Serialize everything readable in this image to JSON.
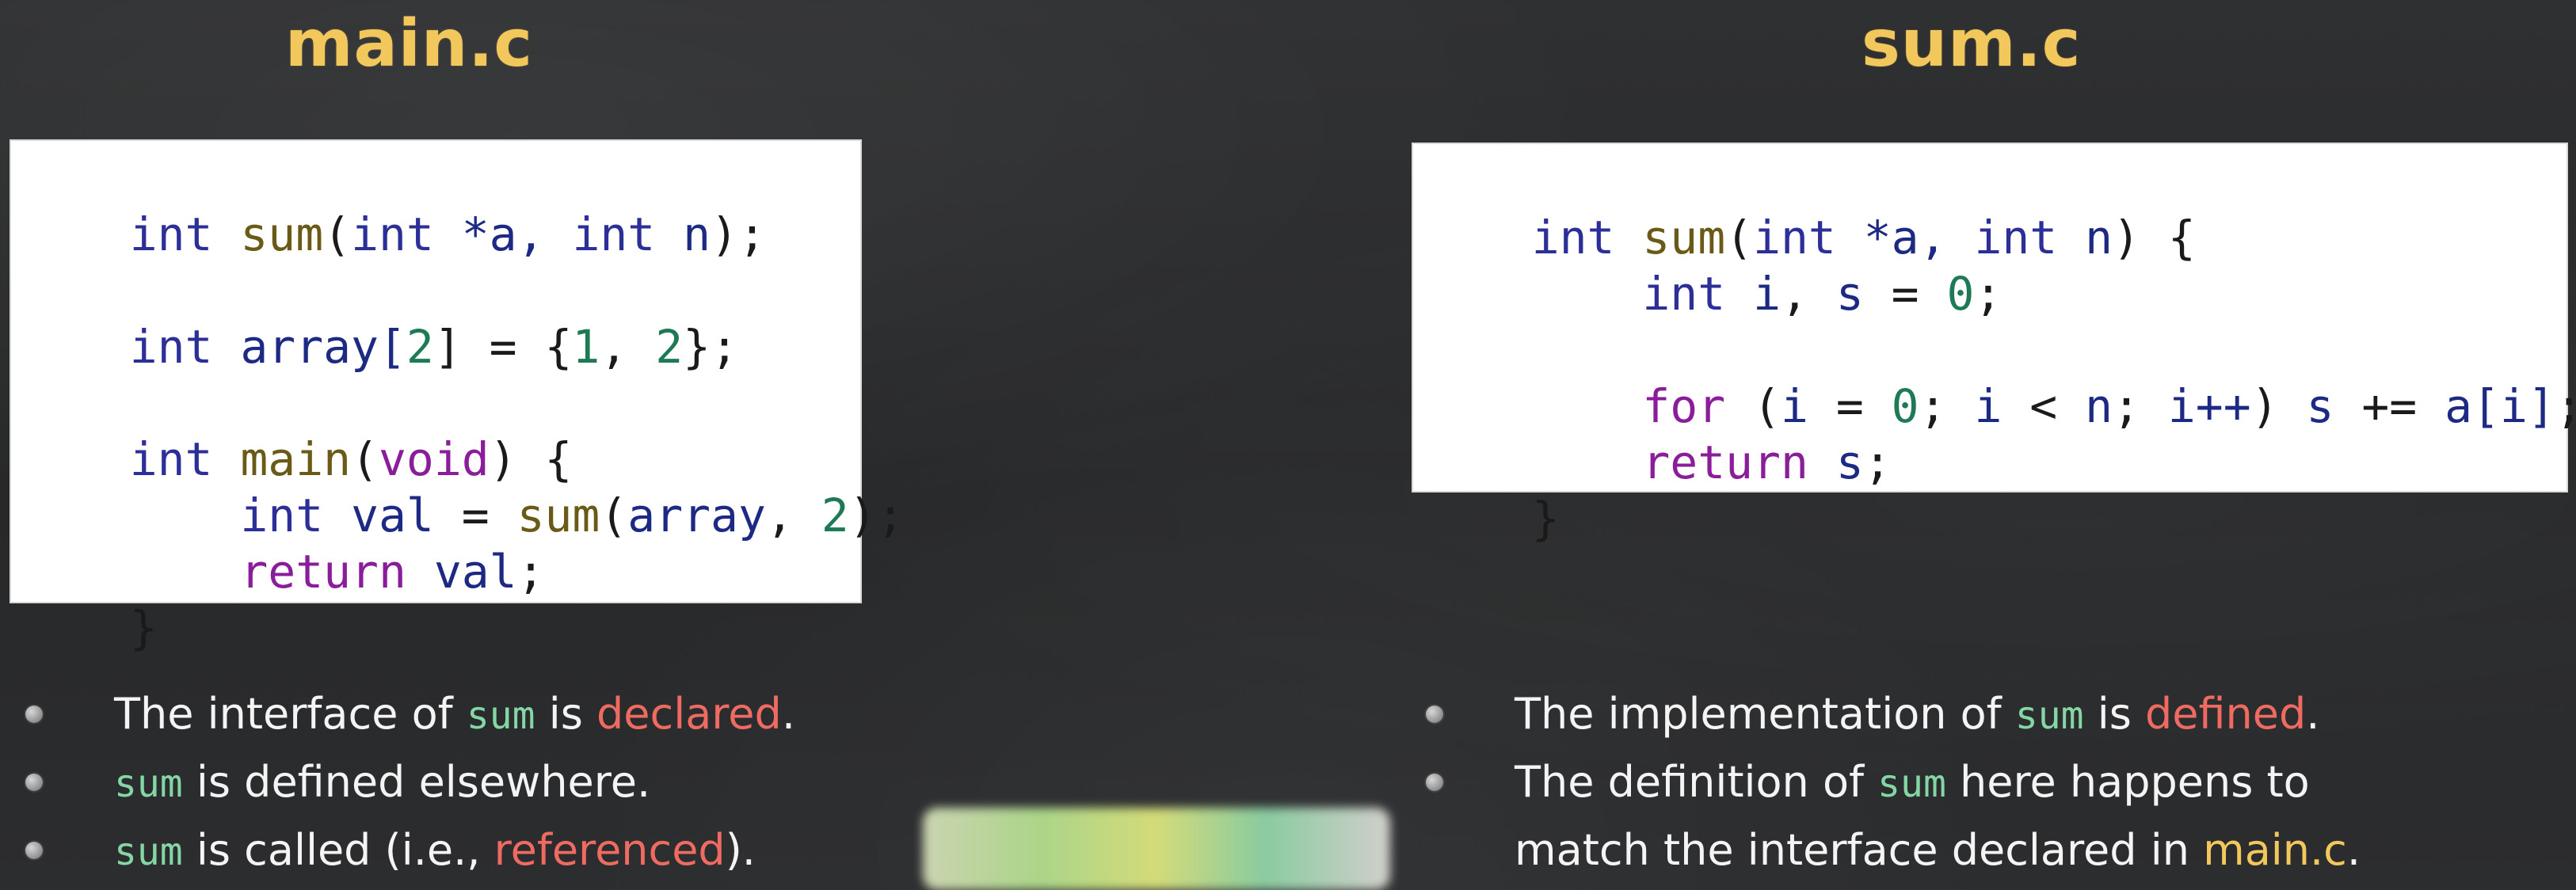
{
  "titles": {
    "left": "main.c",
    "right": "sum.c"
  },
  "code": {
    "left": {
      "line1": {
        "kw": "int",
        "sp1": " ",
        "fn": "sum",
        "open": "(",
        "kw2": "int",
        "sp2": " ",
        "rest": "*a, ",
        "kw3": "int",
        "sp3": " ",
        "id": "n",
        "close": ");"
      },
      "line3": {
        "kw": "int",
        "sp1": " ",
        "id": "array[",
        "num": "2",
        "mid": "] = {",
        "num2": "1",
        "sep": ", ",
        "num3": "2",
        "close": "};"
      },
      "line5": {
        "kw": "int",
        "sp1": " ",
        "fn": "main",
        "open": "(",
        "kw2": "void",
        "close": ") {"
      },
      "line6": {
        "indent": "    ",
        "kw": "int",
        "sp1": " ",
        "id": "val",
        "mid": " = ",
        "fn": "sum",
        "open": "(",
        "arg": "array",
        "sep": ", ",
        "num": "2",
        "close": ");"
      },
      "line7": {
        "indent": "    ",
        "ctl": "return",
        "sp1": " ",
        "id": "val",
        "close": ";"
      },
      "line8": {
        "close": "}"
      }
    },
    "right": {
      "line1": {
        "kw": "int",
        "sp1": " ",
        "fn": "sum",
        "open": "(",
        "kw2": "int",
        "sp2": " ",
        "rest": "*a, ",
        "kw3": "int",
        "sp3": " ",
        "id": "n",
        "close": ") {"
      },
      "line2": {
        "indent": "    ",
        "kw": "int",
        "sp1": " ",
        "id": "i",
        "mid": ", ",
        "id2": "s",
        "eq": " = ",
        "num": "0",
        "close": ";"
      },
      "line4": {
        "indent": "    ",
        "ctl": "for",
        "sp1": " ",
        "open": "(",
        "id": "i",
        "eq": " = ",
        "num": "0",
        "mid": "; ",
        "id2": "i",
        "lt": " < ",
        "id3": "n",
        "mid2": "; ",
        "id4": "i++",
        "close": ") ",
        "id5": "s",
        "plus": " += ",
        "id6": "a[i]",
        "end": ";"
      },
      "line5": {
        "indent": "    ",
        "ctl": "return",
        "sp1": " ",
        "id": "s",
        "close": ";"
      },
      "line6": {
        "close": "}"
      }
    }
  },
  "bullets": {
    "left": [
      {
        "t1": "The interface of ",
        "code": "sum",
        "t2": " is ",
        "accent": "declared",
        "t3": "."
      },
      {
        "code": "sum",
        "t1": " is defined elsewhere."
      },
      {
        "code": "sum",
        "t1": " is called (i.e., ",
        "accent": "referenced",
        "t2": ")."
      }
    ],
    "right": [
      {
        "t1": "The implementation of ",
        "code": "sum",
        "t2": " is ",
        "accent": "defined",
        "t3": "."
      },
      {
        "t1": "The definition of ",
        "code": "sum",
        "t2": " here happens to"
      },
      {
        "t1": "match the interface declared in ",
        "accent": "main.c",
        "t2": "."
      }
    ]
  }
}
